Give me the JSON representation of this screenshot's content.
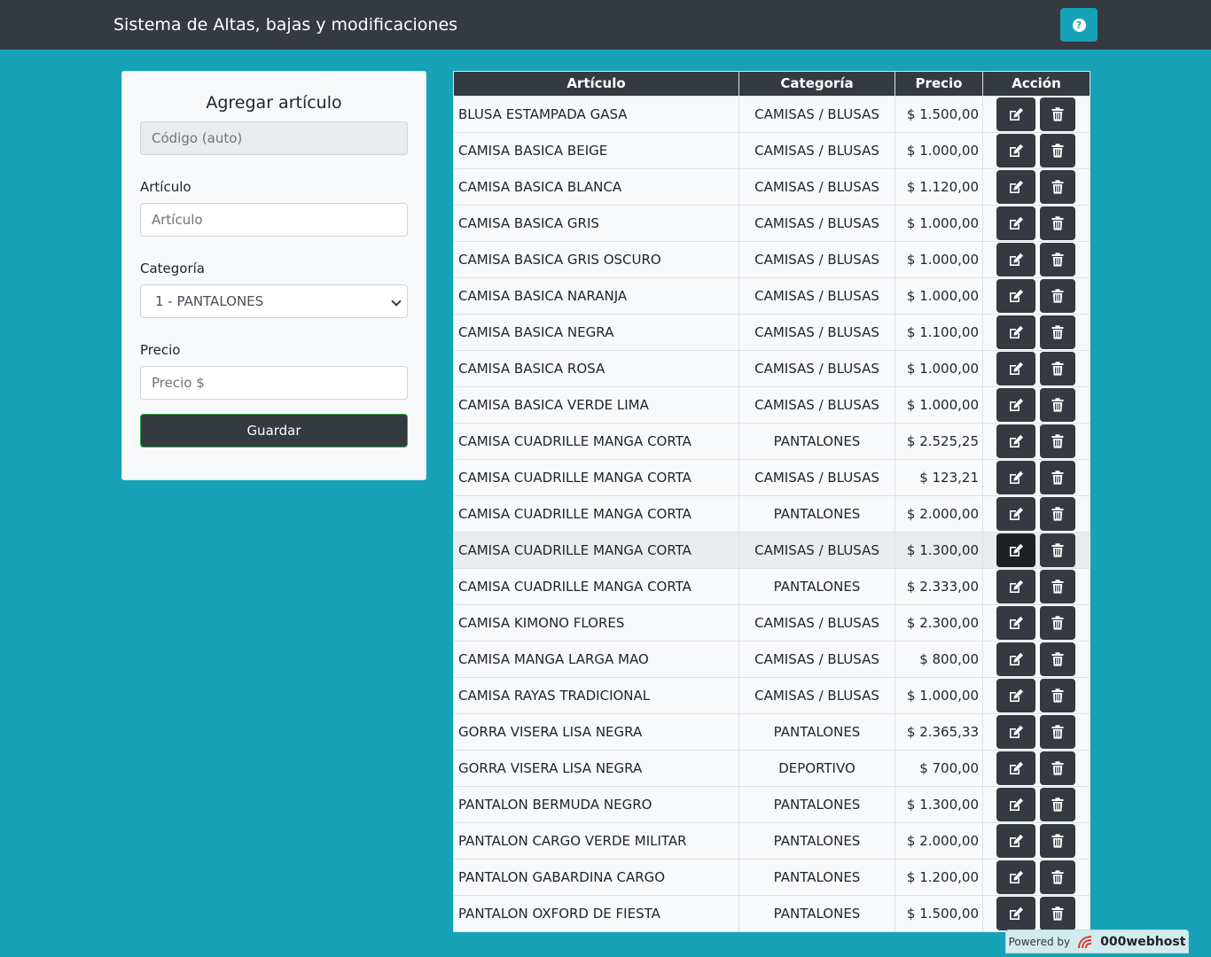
{
  "navbar": {
    "title": "Sistema de Altas, bajas y modificaciones",
    "help_icon": "question-circle-icon"
  },
  "form": {
    "title": "Agregar artículo",
    "code_placeholder": "Código (auto)",
    "article_label": "Artículo",
    "article_placeholder": "Artículo",
    "category_label": "Categoría",
    "category_selected": "1 - PANTALONES",
    "price_label": "Precio",
    "price_placeholder": "Precio $",
    "save_label": "Guardar"
  },
  "table": {
    "headers": [
      "Artículo",
      "Categoría",
      "Precio",
      "Acción"
    ],
    "rows": [
      {
        "articulo": "BLUSA ESTAMPADA GASA",
        "categoria": "CAMISAS / BLUSAS",
        "precio": "$ 1.500,00"
      },
      {
        "articulo": "CAMISA BASICA BEIGE",
        "categoria": "CAMISAS / BLUSAS",
        "precio": "$ 1.000,00"
      },
      {
        "articulo": "CAMISA BASICA BLANCA",
        "categoria": "CAMISAS / BLUSAS",
        "precio": "$ 1.120,00"
      },
      {
        "articulo": "CAMISA BASICA GRIS",
        "categoria": "CAMISAS / BLUSAS",
        "precio": "$ 1.000,00"
      },
      {
        "articulo": "CAMISA BASICA GRIS OSCURO",
        "categoria": "CAMISAS / BLUSAS",
        "precio": "$ 1.000,00"
      },
      {
        "articulo": "CAMISA BASICA NARANJA",
        "categoria": "CAMISAS / BLUSAS",
        "precio": "$ 1.000,00"
      },
      {
        "articulo": "CAMISA BASICA NEGRA",
        "categoria": "CAMISAS / BLUSAS",
        "precio": "$ 1.100,00"
      },
      {
        "articulo": "CAMISA BASICA ROSA",
        "categoria": "CAMISAS / BLUSAS",
        "precio": "$ 1.000,00"
      },
      {
        "articulo": "CAMISA BASICA VERDE LIMA",
        "categoria": "CAMISAS / BLUSAS",
        "precio": "$ 1.000,00"
      },
      {
        "articulo": "CAMISA CUADRILLE MANGA CORTA",
        "categoria": "PANTALONES",
        "precio": "$ 2.525,25"
      },
      {
        "articulo": "CAMISA CUADRILLE MANGA CORTA",
        "categoria": "CAMISAS / BLUSAS",
        "precio": "$ 123,21"
      },
      {
        "articulo": "CAMISA CUADRILLE MANGA CORTA",
        "categoria": "PANTALONES",
        "precio": "$ 2.000,00"
      },
      {
        "articulo": "CAMISA CUADRILLE MANGA CORTA",
        "categoria": "CAMISAS / BLUSAS",
        "precio": "$ 1.300,00",
        "hover": true
      },
      {
        "articulo": "CAMISA CUADRILLE MANGA CORTA",
        "categoria": "PANTALONES",
        "precio": "$ 2.333,00"
      },
      {
        "articulo": "CAMISA KIMONO FLORES",
        "categoria": "CAMISAS / BLUSAS",
        "precio": "$ 2.300,00"
      },
      {
        "articulo": "CAMISA MANGA LARGA MAO",
        "categoria": "CAMISAS / BLUSAS",
        "precio": "$ 800,00"
      },
      {
        "articulo": "CAMISA RAYAS TRADICIONAL",
        "categoria": "CAMISAS / BLUSAS",
        "precio": "$ 1.000,00"
      },
      {
        "articulo": "GORRA VISERA LISA NEGRA",
        "categoria": "PANTALONES",
        "precio": "$ 2.365,33"
      },
      {
        "articulo": "GORRA VISERA LISA NEGRA",
        "categoria": "DEPORTIVO",
        "precio": "$ 700,00"
      },
      {
        "articulo": "PANTALON BERMUDA NEGRO",
        "categoria": "PANTALONES",
        "precio": "$ 1.300,00"
      },
      {
        "articulo": "PANTALON CARGO VERDE MILITAR",
        "categoria": "PANTALONES",
        "precio": "$ 2.000,00"
      },
      {
        "articulo": "PANTALON GABARDINA CARGO",
        "categoria": "PANTALONES",
        "precio": "$ 1.200,00"
      },
      {
        "articulo": "PANTALON OXFORD DE FIESTA",
        "categoria": "PANTALONES",
        "precio": "$ 1.500,00"
      }
    ],
    "edit_icon": "edit-icon",
    "delete_icon": "trash-icon"
  },
  "footer": {
    "powered_text": "Powered by",
    "brand": "000webhost"
  },
  "colors": {
    "background": "#17a2b8",
    "navbar": "#343a40",
    "button_dark": "#343a40"
  }
}
